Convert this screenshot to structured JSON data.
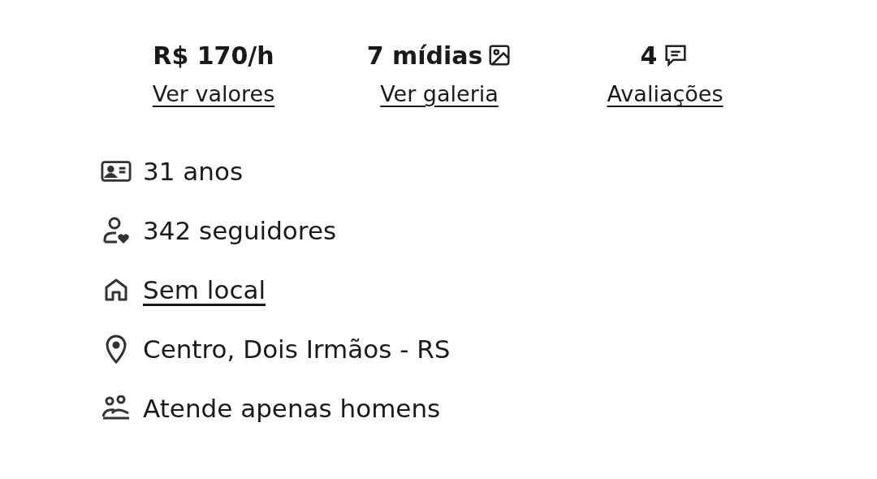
{
  "stats": [
    {
      "kind": "price",
      "value": "R$ 170/h",
      "link": "Ver valores"
    },
    {
      "kind": "media",
      "value": "7 mídias",
      "link": "Ver galeria"
    },
    {
      "kind": "reviews",
      "value": "4",
      "link": "Avaliações"
    }
  ],
  "details": [
    {
      "kind": "age",
      "text": "31 anos",
      "link": false
    },
    {
      "kind": "followers",
      "text": "342 seguidores",
      "link": false
    },
    {
      "kind": "home",
      "text": "Sem local",
      "link": true
    },
    {
      "kind": "location",
      "text": "Centro, Dois Irmãos - RS",
      "link": false
    },
    {
      "kind": "audience",
      "text": "Atende apenas homens",
      "link": false
    }
  ]
}
